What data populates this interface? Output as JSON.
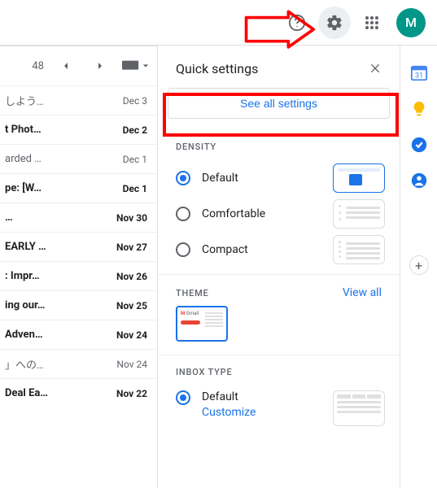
{
  "topbar": {
    "avatar_letter": "M"
  },
  "list": {
    "page_count": "48",
    "rows": [
      {
        "subject": "しよう…",
        "date": "Dec 3",
        "unread": false
      },
      {
        "subject": "t Phot…",
        "date": "Dec 2",
        "unread": true
      },
      {
        "subject": "arded …",
        "date": "Dec 1",
        "unread": false
      },
      {
        "subject": "pe: [W…",
        "date": "Dec 1",
        "unread": true
      },
      {
        "subject": "…",
        "date": "Nov 30",
        "unread": true
      },
      {
        "subject": "EARLY …",
        "date": "Nov 27",
        "unread": true
      },
      {
        "subject": ": Impr…",
        "date": "Nov 26",
        "unread": true
      },
      {
        "subject": "ing our…",
        "date": "Nov 25",
        "unread": true
      },
      {
        "subject": "Adven…",
        "date": "Nov 24",
        "unread": true
      },
      {
        "subject": "」への…",
        "date": "Nov 24",
        "unread": false
      },
      {
        "subject": "Deal Ea…",
        "date": "Nov 22",
        "unread": true
      }
    ]
  },
  "panel": {
    "title": "Quick settings",
    "see_all": "See all settings",
    "density_title": "DENSITY",
    "density": [
      {
        "label": "Default",
        "checked": true
      },
      {
        "label": "Comfortable",
        "checked": false
      },
      {
        "label": "Compact",
        "checked": false
      }
    ],
    "theme_title": "THEME",
    "view_all": "View all",
    "inbox_title": "INBOX TYPE",
    "inbox": {
      "label": "Default",
      "customize": "Customize",
      "checked": true
    }
  }
}
